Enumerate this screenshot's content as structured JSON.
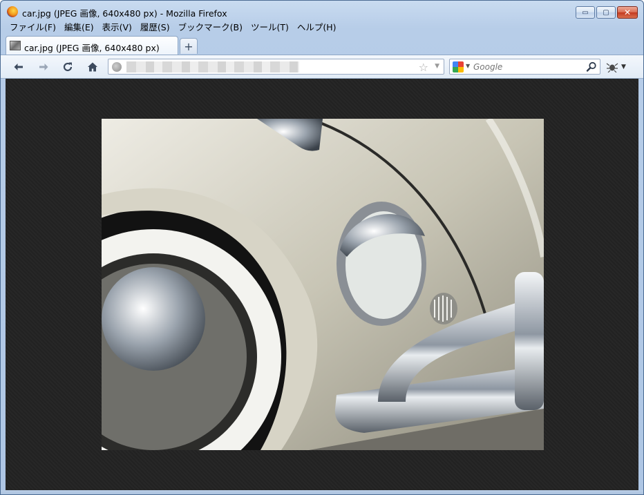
{
  "window": {
    "title": "car.jpg (JPEG 画像, 640x480 px) - Mozilla Firefox",
    "buttons": {
      "minimize": "▭",
      "maximize": "▢",
      "close": "✕"
    }
  },
  "menu": {
    "items": [
      {
        "label": "ファイル(F)"
      },
      {
        "label": "編集(E)"
      },
      {
        "label": "表示(V)"
      },
      {
        "label": "履歴(S)"
      },
      {
        "label": "ブックマーク(B)"
      },
      {
        "label": "ツール(T)"
      },
      {
        "label": "ヘルプ(H)"
      }
    ]
  },
  "tabs": {
    "active": {
      "label": "car.jpg (JPEG 画像, 640x480 px)"
    },
    "new_tab_label": "+"
  },
  "navbar": {
    "search": {
      "placeholder": "Google"
    }
  },
  "icons": {
    "back": "back-arrow-icon",
    "forward": "forward-arrow-icon",
    "reload": "reload-icon",
    "home": "home-icon",
    "bookmark_star": "star-icon",
    "search": "magnifier-icon"
  },
  "colors": {
    "content_background": "#222222",
    "chrome_blue": "#c9dbf0",
    "close_red": "#c3391f"
  }
}
